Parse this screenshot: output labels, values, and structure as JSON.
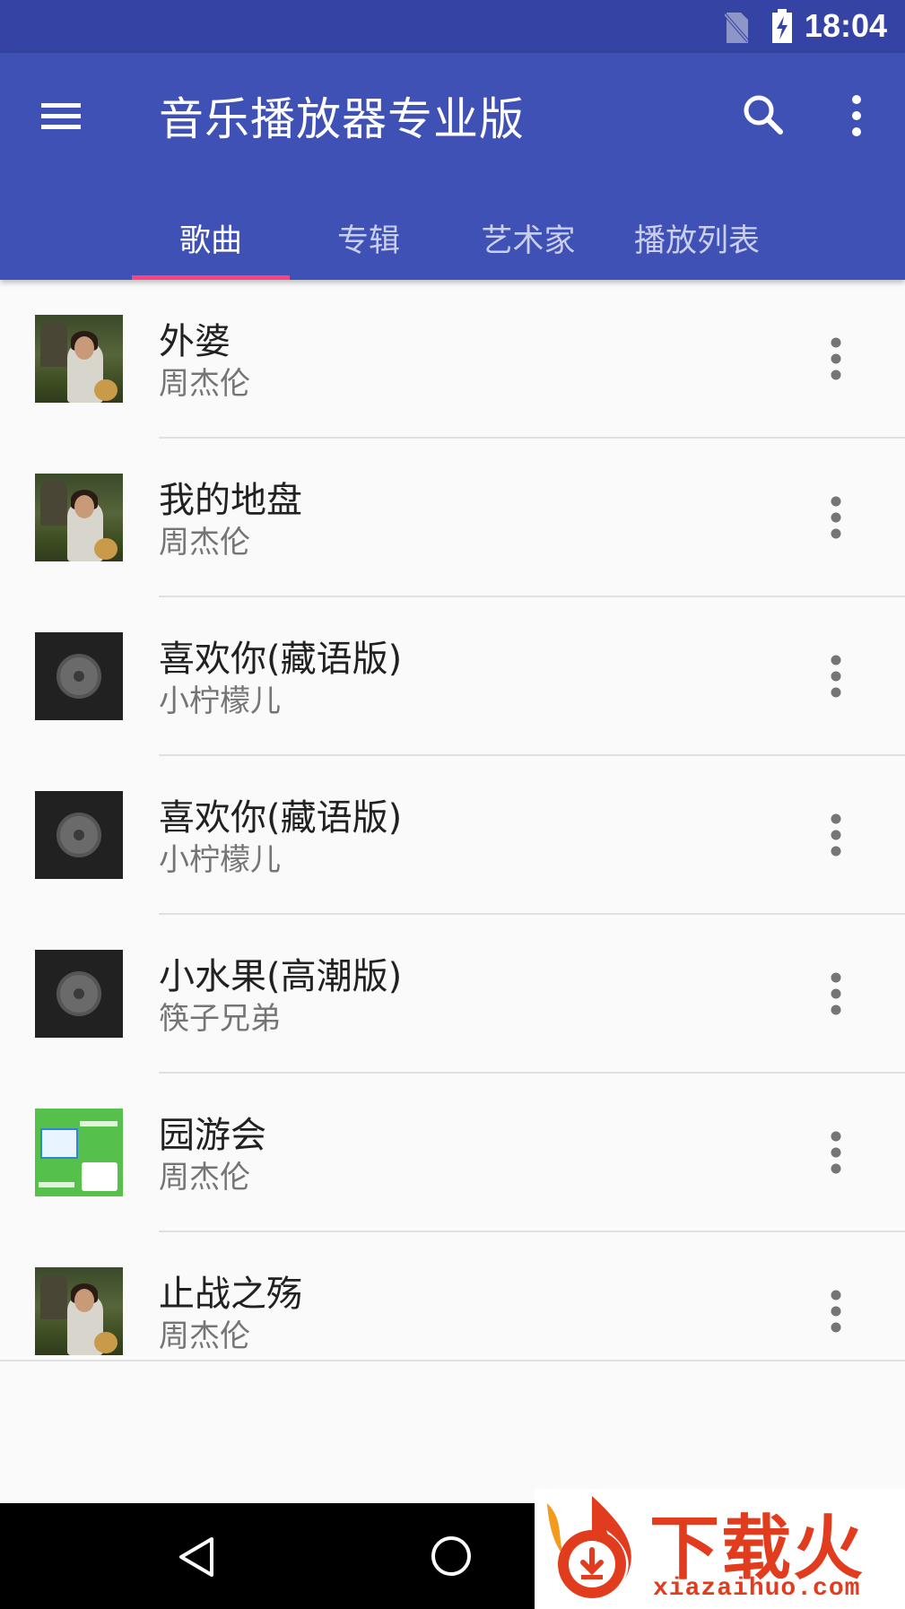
{
  "status_bar": {
    "time": "18:04"
  },
  "app_bar": {
    "title": "音乐播放器专业版",
    "menu_icon": "hamburger-menu-icon",
    "search_icon": "search-icon",
    "more_icon": "more-vert-icon"
  },
  "tabs": [
    {
      "label": "歌曲",
      "active": true
    },
    {
      "label": "专辑",
      "active": false
    },
    {
      "label": "艺术家",
      "active": false
    },
    {
      "label": "播放列表",
      "active": false
    }
  ],
  "colors": {
    "primary": "#3f51b5",
    "primary_dark": "#3543a4",
    "accent": "#ff4081"
  },
  "songs": [
    {
      "title": "外婆",
      "artist": "周杰伦",
      "cover": "album-photo"
    },
    {
      "title": "我的地盘",
      "artist": "周杰伦",
      "cover": "album-photo"
    },
    {
      "title": "喜欢你(藏语版)",
      "artist": "小柠檬儿",
      "cover": "default-disc"
    },
    {
      "title": "喜欢你(藏语版)",
      "artist": "小柠檬儿",
      "cover": "default-disc"
    },
    {
      "title": "小水果(高潮版)",
      "artist": "筷子兄弟",
      "cover": "default-disc"
    },
    {
      "title": "园游会",
      "artist": "周杰伦",
      "cover": "green-screenshot"
    },
    {
      "title": "止战之殇",
      "artist": "周杰伦",
      "cover": "album-photo"
    }
  ],
  "watermark": {
    "brand": "下载火",
    "url": "xiazaihuo.com"
  }
}
